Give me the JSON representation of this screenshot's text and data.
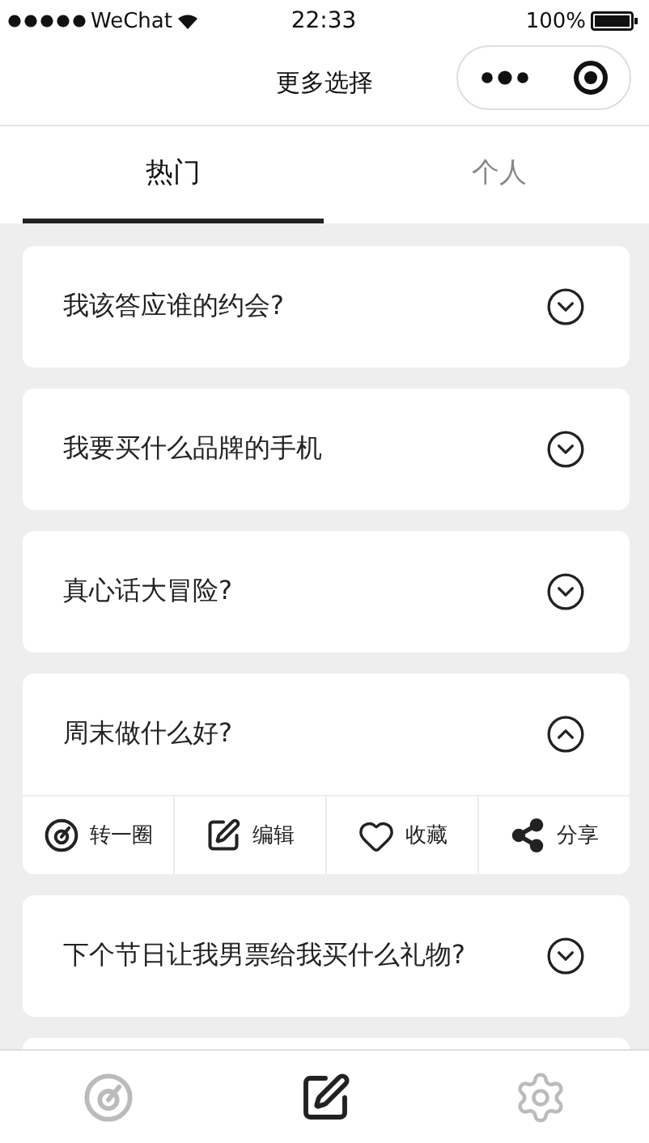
{
  "status_bar": {
    "carrier": "WeChat",
    "time": "22:33",
    "battery": "100%"
  },
  "nav": {
    "title": "更多选择"
  },
  "tabs": [
    {
      "label": "热门",
      "selected": true
    },
    {
      "label": "个人",
      "selected": false
    }
  ],
  "questions": [
    {
      "title": "我该答应谁的约会?",
      "expanded": false
    },
    {
      "title": "我要买什么品牌的手机",
      "expanded": false
    },
    {
      "title": "真心话大冒险?",
      "expanded": false
    },
    {
      "title": "周末做什么好?",
      "expanded": true
    },
    {
      "title": "下个节日让我男票给我买什么礼物?",
      "expanded": false
    }
  ],
  "actions": [
    {
      "kind": "spin",
      "label": "转一圈"
    },
    {
      "kind": "edit",
      "label": "编辑"
    },
    {
      "kind": "favorite",
      "label": "收藏"
    },
    {
      "kind": "share",
      "label": "分享"
    }
  ],
  "bottom_tabs": [
    {
      "kind": "spin",
      "selected": false
    },
    {
      "kind": "edit",
      "selected": true
    },
    {
      "kind": "settings",
      "selected": false
    }
  ]
}
